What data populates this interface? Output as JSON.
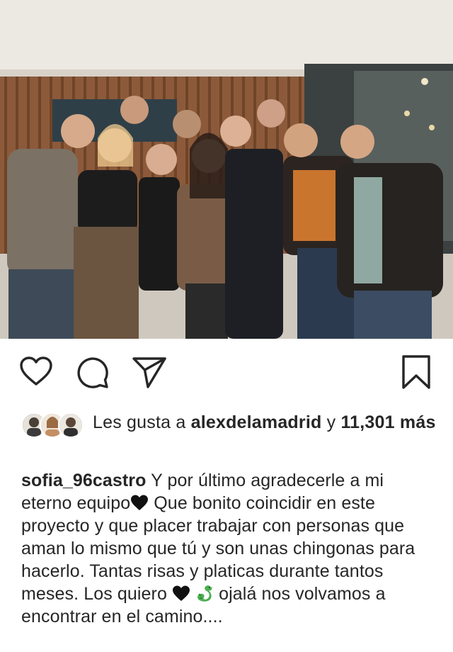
{
  "post": {
    "image_alt": "Group photo",
    "actions": {
      "like_icon": "heart-outline-icon",
      "comment_icon": "comment-bubble-icon",
      "share_icon": "paper-plane-icon",
      "save_icon": "bookmark-icon"
    },
    "likes": {
      "prefix": "Les gusta a ",
      "user": "alexdelamadrid",
      "connector": " y ",
      "count": "11,301",
      "suffix": "más"
    },
    "caption": {
      "username": "sofia_96castro",
      "part1": " Y por último agradecerle a mi eterno equipo",
      "part2": " Que bonito coincidir en este proyecto y que placer trabajar con personas que aman lo mismo que tú y son unas chingonas para hacerlo. Tantas risas y platicas durante tantos meses. Los quiero ",
      "part3": " ojalá nos volvamos a encontrar en el camino....",
      "emojis": [
        "black-heart",
        "black-heart",
        "dragon"
      ]
    }
  },
  "colors": {
    "text": "#262626",
    "background": "#ffffff"
  }
}
